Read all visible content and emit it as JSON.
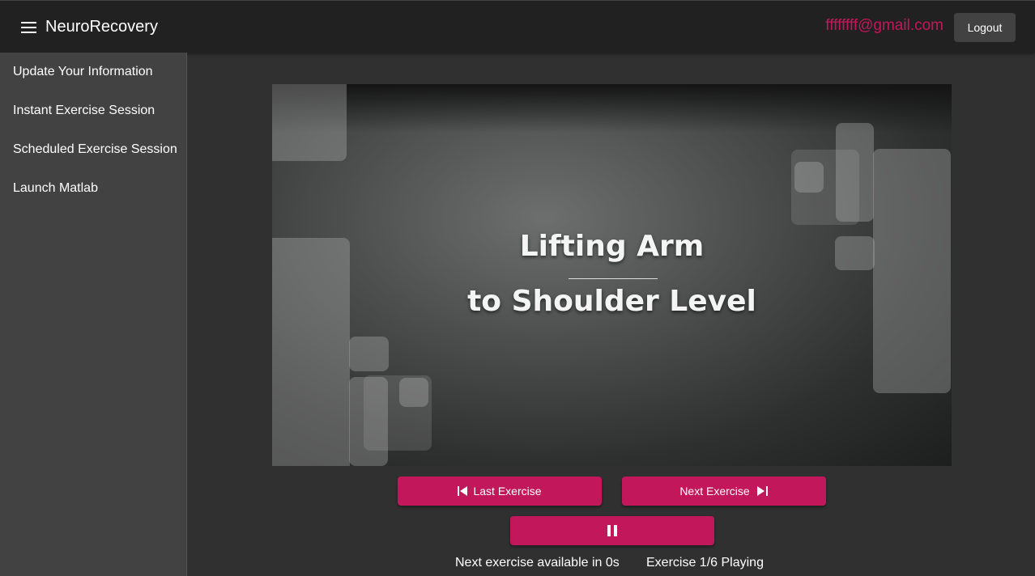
{
  "header": {
    "app_title": "NeuroRecovery",
    "user_email": "ffffffff@gmail.com",
    "logout_label": "Logout"
  },
  "sidebar": {
    "items": [
      {
        "label": "Update Your Information"
      },
      {
        "label": "Instant Exercise Session"
      },
      {
        "label": "Scheduled Exercise Session"
      },
      {
        "label": "Launch Matlab"
      }
    ]
  },
  "video": {
    "title_line1": "Lifting Arm",
    "title_line2": "to Shoulder Level"
  },
  "controls": {
    "last_label": "Last Exercise",
    "next_label": "Next Exercise",
    "pause_icon": "pause-icon"
  },
  "status": {
    "countdown": "Next exercise available in 0s",
    "progress": "Exercise 1/6 Playing"
  },
  "colors": {
    "accent": "#c2185b",
    "topbar": "#212121",
    "sidebar": "#424242",
    "background": "#303030"
  }
}
